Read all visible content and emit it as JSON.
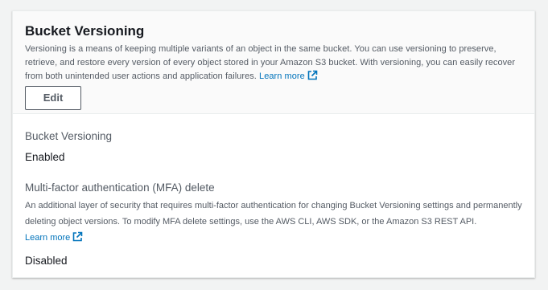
{
  "header": {
    "title": "Bucket Versioning",
    "description": "Versioning is a means of keeping multiple variants of an object in the same bucket. You can use versioning to preserve, retrieve, and restore every version of every object stored in your Amazon S3 bucket. With versioning, you can easily recover from both unintended user actions and application failures.",
    "learn_more": "Learn more",
    "edit_label": "Edit"
  },
  "fields": {
    "versioning": {
      "label": "Bucket Versioning",
      "value": "Enabled"
    },
    "mfa": {
      "label": "Multi-factor authentication (MFA) delete",
      "description": "An additional layer of security that requires multi-factor authentication for changing Bucket Versioning settings and permanently deleting object versions. To modify MFA delete settings, use the AWS CLI, AWS SDK, or the Amazon S3 REST API.",
      "learn_more": "Learn more",
      "value": "Disabled"
    }
  },
  "colors": {
    "link": "#0073bb",
    "text": "#16191f",
    "secondary_text": "#545b64",
    "header_bg": "#fafafa"
  },
  "icons": {
    "external_link": "external-link-icon"
  }
}
